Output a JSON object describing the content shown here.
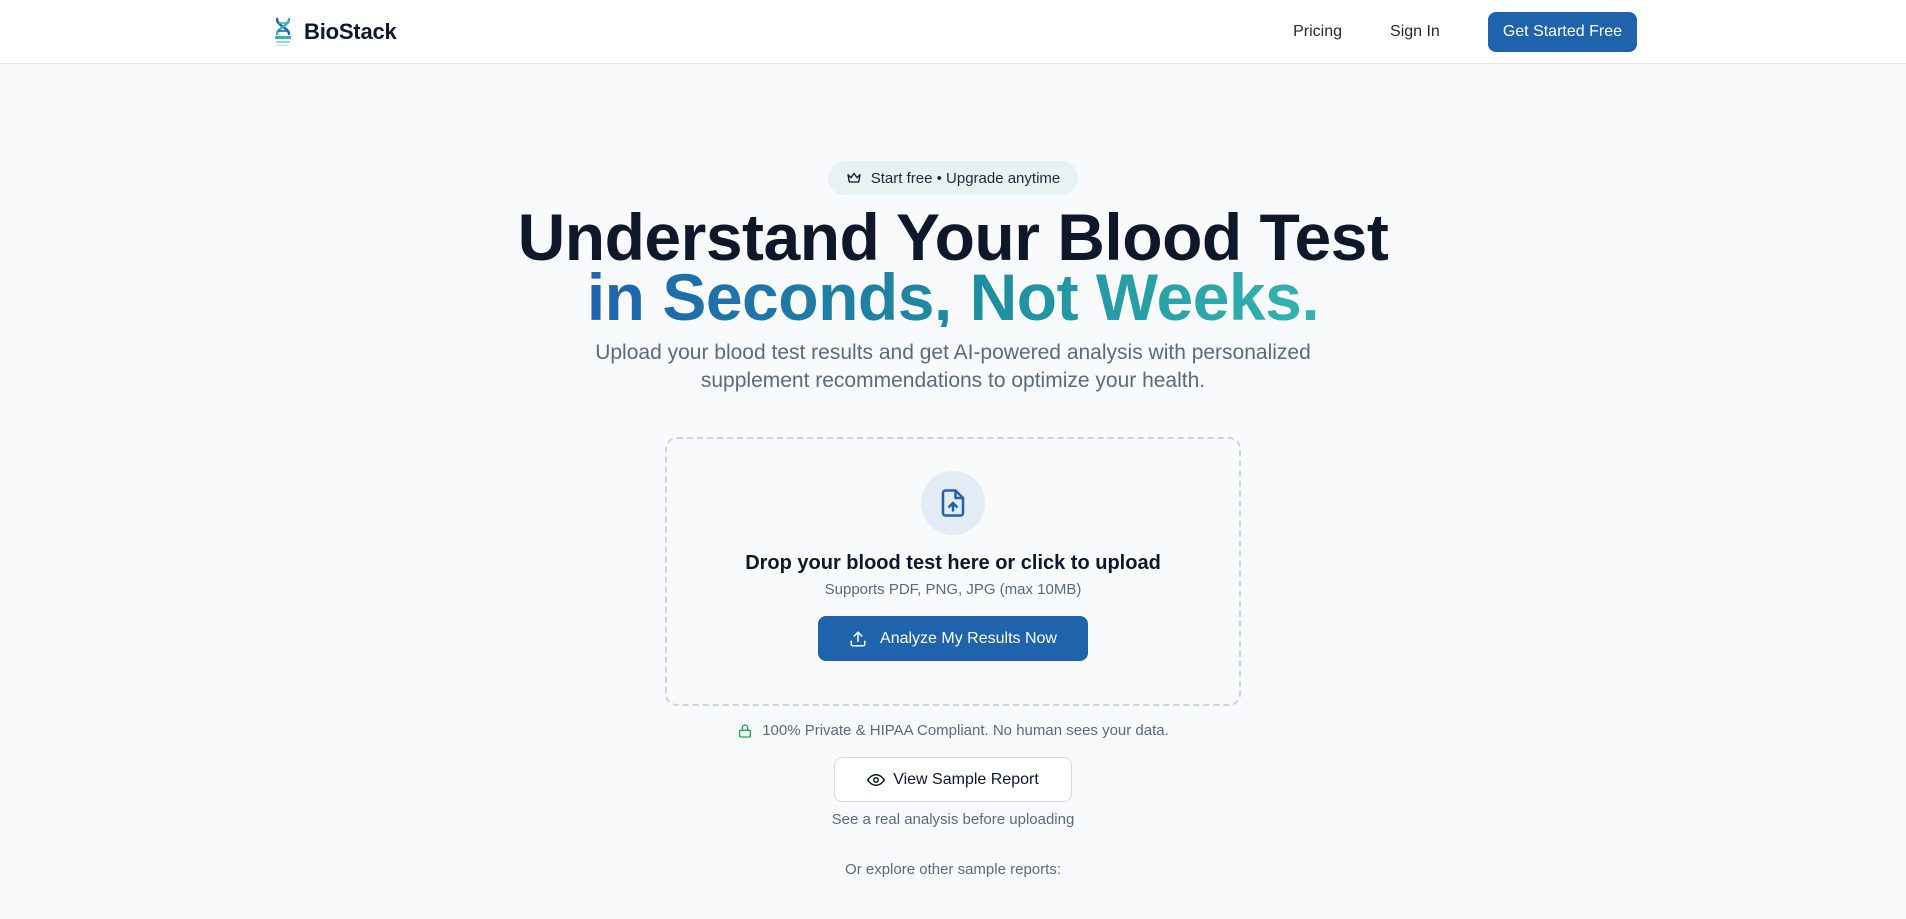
{
  "header": {
    "brand_name": "BioStack",
    "brand_icon": "dna-icon",
    "nav": {
      "pricing": "Pricing",
      "sign_in": "Sign In",
      "cta": "Get Started Free"
    }
  },
  "hero": {
    "badge": {
      "icon": "crown-icon",
      "text": "Start free • Upgrade anytime"
    },
    "title_line1": "Understand Your Blood Test",
    "title_line2": "in Seconds, Not Weeks.",
    "subtitle": "Upload your blood test results and get AI-powered analysis with personalized supplement recommendations to optimize your health."
  },
  "upload": {
    "icon": "file-upload-icon",
    "title": "Drop your blood test here or click to upload",
    "hint": "Supports PDF, PNG, JPG (max 10MB)",
    "button_icon": "upload-icon",
    "button_label": "Analyze My Results Now"
  },
  "privacy": {
    "icon": "lock-icon",
    "text": "100% Private & HIPAA Compliant. No human sees your data."
  },
  "sample": {
    "icon": "eye-icon",
    "button_label": "View Sample Report",
    "note": "See a real analysis before uploading",
    "explore": "Or explore other sample reports:"
  },
  "colors": {
    "primary": "#1f63ad",
    "teal": "#34b3b0",
    "background": "#f9fafb",
    "privacy_green": "#22a35a"
  }
}
